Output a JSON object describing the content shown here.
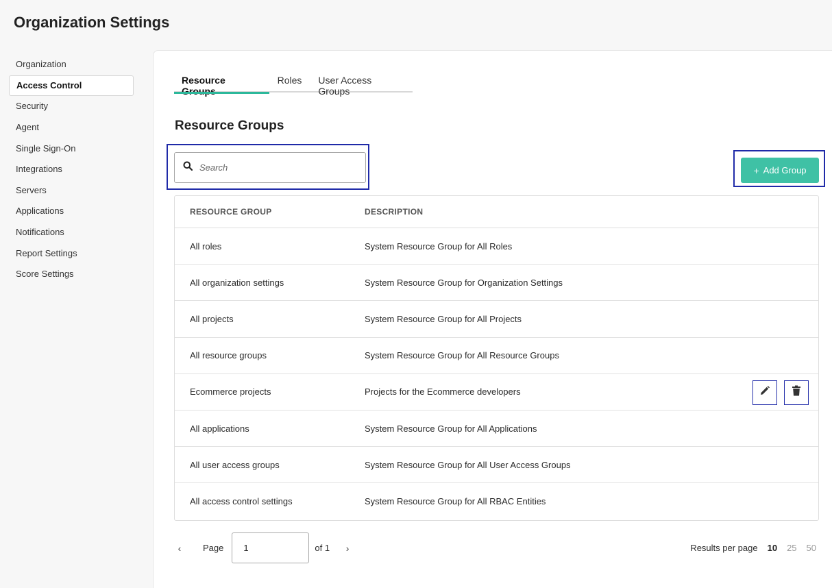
{
  "page": {
    "title": "Organization Settings"
  },
  "sidebar": {
    "items": [
      {
        "label": "Organization",
        "active": false
      },
      {
        "label": "Access Control",
        "active": true
      },
      {
        "label": "Security",
        "active": false
      },
      {
        "label": "Agent",
        "active": false
      },
      {
        "label": "Single Sign-On",
        "active": false
      },
      {
        "label": "Integrations",
        "active": false
      },
      {
        "label": "Servers",
        "active": false
      },
      {
        "label": "Applications",
        "active": false
      },
      {
        "label": "Notifications",
        "active": false
      },
      {
        "label": "Report Settings",
        "active": false
      },
      {
        "label": "Score Settings",
        "active": false
      }
    ]
  },
  "tabs": [
    {
      "label": "Resource Groups",
      "active": true
    },
    {
      "label": "Roles",
      "active": false
    },
    {
      "label": "User Access Groups",
      "active": false
    }
  ],
  "section": {
    "title": "Resource Groups"
  },
  "search": {
    "placeholder": "Search",
    "value": "",
    "icon": "search-icon"
  },
  "add_button": {
    "label": "Add Group",
    "icon": "plus-icon"
  },
  "table": {
    "headers": [
      "RESOURCE GROUP",
      "DESCRIPTION"
    ],
    "rows": [
      {
        "name": "All roles",
        "description": "System Resource Group for All Roles",
        "actions": false
      },
      {
        "name": "All organization settings",
        "description": "System Resource Group for Organization Settings",
        "actions": false
      },
      {
        "name": "All projects",
        "description": "System Resource Group for All Projects",
        "actions": false
      },
      {
        "name": "All resource groups",
        "description": "System Resource Group for All Resource Groups",
        "actions": false
      },
      {
        "name": "Ecommerce projects",
        "description": "Projects for the Ecommerce developers",
        "actions": true
      },
      {
        "name": "All applications",
        "description": "System Resource Group for All Applications",
        "actions": false
      },
      {
        "name": "All user access groups",
        "description": "System Resource Group for All User Access Groups",
        "actions": false
      },
      {
        "name": "All access control settings",
        "description": "System Resource Group for All RBAC Entities",
        "actions": false
      }
    ],
    "row_action_icons": [
      "pencil-icon",
      "trash-icon"
    ]
  },
  "pagination": {
    "page_label": "Page",
    "current_page": "1",
    "of_label": "of 1",
    "results_label": "Results per page",
    "per_page_options": [
      "10",
      "25",
      "50"
    ],
    "selected_per_page": "10"
  },
  "colors": {
    "accent": "#3fc1a5",
    "tab_underline": "#2cb89b",
    "highlight": "#1f2aa8"
  }
}
